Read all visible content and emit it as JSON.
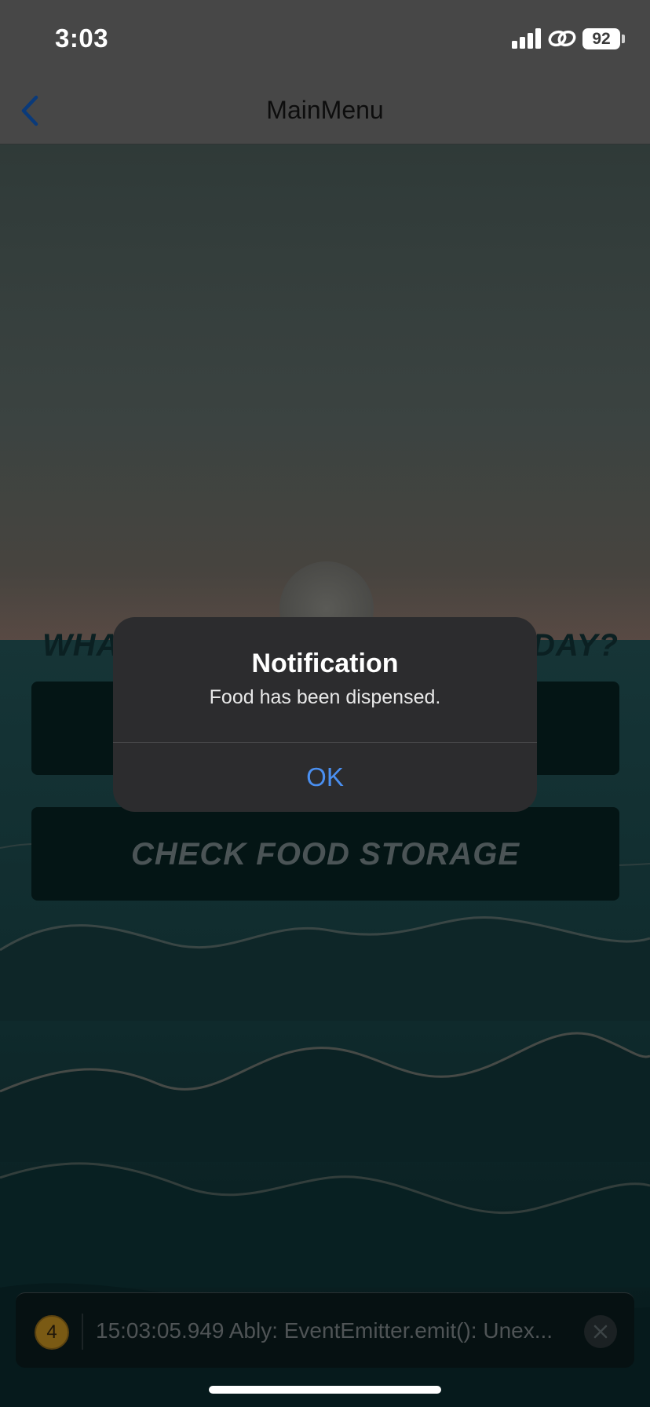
{
  "status_bar": {
    "time": "3:03",
    "battery": "92",
    "icons": [
      "signal-icon",
      "link-icon",
      "battery-icon"
    ]
  },
  "nav": {
    "title": "MainMenu",
    "back_icon": "chevron-left-icon"
  },
  "main": {
    "question_left": "WHAT",
    "question_right": "DAY?",
    "button_1_label": "",
    "button_2_label": "CHECK FOOD STORAGE"
  },
  "dialog": {
    "title": "Notification",
    "message": "Food has been dispensed.",
    "ok_label": "OK"
  },
  "log": {
    "count": "4",
    "message": "15:03:05.949 Ably: EventEmitter.emit(): Unex..."
  },
  "colors": {
    "accent": "#4a8ff0",
    "dialog_bg": "#2c2c2e",
    "button_bg": "#041515"
  }
}
